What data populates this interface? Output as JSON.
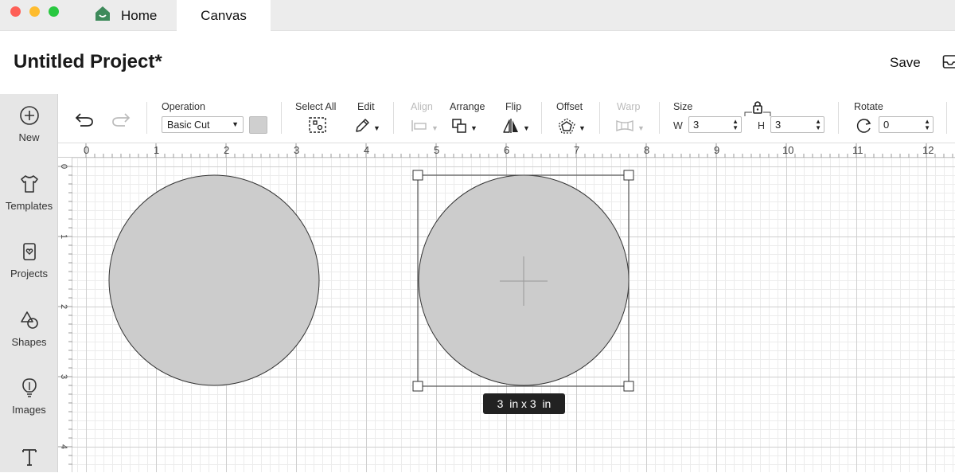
{
  "window": {
    "traffic_lights": {
      "close": "#fe5f57",
      "minimize": "#febc2e",
      "maximize": "#28c840"
    },
    "tabs": [
      {
        "label": "Home",
        "icon": "home-icon"
      },
      {
        "label": "Canvas"
      }
    ]
  },
  "header": {
    "project_title": "Untitled Project*",
    "save_label": "Save",
    "icon": "tray-icon"
  },
  "sidebar": {
    "items": [
      {
        "label": "New",
        "icon": "plus-circle-icon"
      },
      {
        "label": "Templates",
        "icon": "tshirt-icon"
      },
      {
        "label": "Projects",
        "icon": "projects-icon"
      },
      {
        "label": "Shapes",
        "icon": "shapes-icon"
      },
      {
        "label": "Images",
        "icon": "lightbulb-icon"
      },
      {
        "label": "",
        "icon": "text-icon"
      }
    ]
  },
  "toolbar": {
    "operation_label": "Operation",
    "operation_value": "Basic Cut",
    "select_all_label": "Select All",
    "edit_label": "Edit",
    "align_label": "Align",
    "arrange_label": "Arrange",
    "flip_label": "Flip",
    "offset_label": "Offset",
    "warp_label": "Warp",
    "size_label": "Size",
    "w_label": "W",
    "w_value": "3",
    "h_label": "H",
    "h_value": "3",
    "rotate_label": "Rotate",
    "rotate_value": "0"
  },
  "ruler": {
    "top_numbers": [
      "0",
      "1",
      "2",
      "3",
      "4",
      "5",
      "6",
      "7",
      "8",
      "9",
      "10",
      "11",
      "12"
    ],
    "left_numbers": [
      "0",
      "1",
      "2",
      "3",
      "4"
    ]
  },
  "canvas": {
    "shape_fill": "#cccccc",
    "selection_size_label": "3  in x 3  in"
  }
}
